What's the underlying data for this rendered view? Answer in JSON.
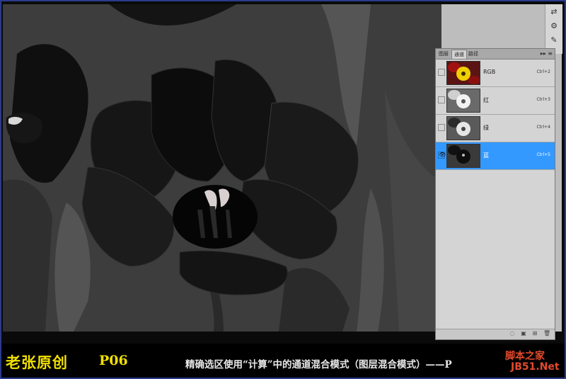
{
  "panel": {
    "tabs": [
      "图层",
      "通道",
      "路径"
    ],
    "active_tab": 1,
    "menu_glyph": "▸▸ ≡",
    "channels": [
      {
        "name": "RGB",
        "shortcut": "Ctrl+2",
        "selected": false,
        "visible": false,
        "thumb": "color"
      },
      {
        "name": "红",
        "shortcut": "Ctrl+3",
        "selected": false,
        "visible": false,
        "thumb": "light"
      },
      {
        "name": "绿",
        "shortcut": "Ctrl+4",
        "selected": false,
        "visible": false,
        "thumb": "light"
      },
      {
        "name": "蓝",
        "shortcut": "Ctrl+5",
        "selected": true,
        "visible": true,
        "thumb": "dark"
      }
    ]
  },
  "caption": {
    "author": "老张原创",
    "page": "P06",
    "description": "精确选区使用“计算”中的通道混合模式（图层混合模式）——P"
  },
  "watermark": {
    "line1": "脚本之家",
    "line2": "JB51.Net"
  },
  "colors": {
    "selection": "#3399ff",
    "caption_yellow": "#f0e000",
    "frame_border": "#2b3a8c"
  }
}
